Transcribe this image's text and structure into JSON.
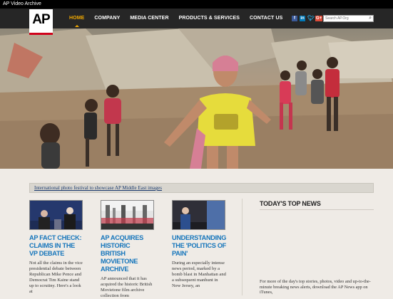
{
  "window": {
    "title": "AP Video Archive"
  },
  "logo": {
    "text": "AP"
  },
  "nav": {
    "items": [
      {
        "label": "HOME",
        "active": true
      },
      {
        "label": "COMPANY",
        "active": false
      },
      {
        "label": "MEDIA CENTER",
        "active": false
      },
      {
        "label": "PRODUCTS & SERVICES",
        "active": false
      },
      {
        "label": "CONTACT US",
        "active": false
      }
    ]
  },
  "social": {
    "icons": [
      "facebook-icon",
      "linkedin-icon",
      "twitter-icon",
      "google-plus-icon"
    ],
    "labels": {
      "facebook": "f",
      "linkedin": "in",
      "twitter": "t",
      "google_plus": "G+"
    }
  },
  "search": {
    "placeholder": "Search AP.Org"
  },
  "banner": {
    "link_text": "International photo festival to showcase AP Middle East images"
  },
  "articles": [
    {
      "title": "AP FACT CHECK: CLAIMS IN THE VP DEBATE",
      "excerpt": "Not all the claims in the vice presidential debate between Republican Mike Pence and Democrat Tim Kaine stand up to scrutiny. Here's a look at"
    },
    {
      "title": "AP ACQUIRES HISTORIC BRITISH MOVIETONE ARCHIVE",
      "excerpt": "AP announced that it has acquired the historic British Movietone film archive collection from"
    },
    {
      "title": "UNDERSTANDING THE 'POLITICS OF PAIN'",
      "excerpt": "During an especially intense news period, marked by a bomb blast in Manhattan and a subsequent manhunt in New Jersey, an"
    }
  ],
  "sidebar": {
    "heading": "TODAY'S TOP NEWS",
    "apps_text": "For more of the day's top stories, photos, video and up-to-the-minute breaking news alerts, download the AP News app on iTunes,"
  },
  "colors": {
    "accent": "#f2a900",
    "link": "#1575bb",
    "logo_red": "#d0021b",
    "nav_bg": "#262626"
  }
}
